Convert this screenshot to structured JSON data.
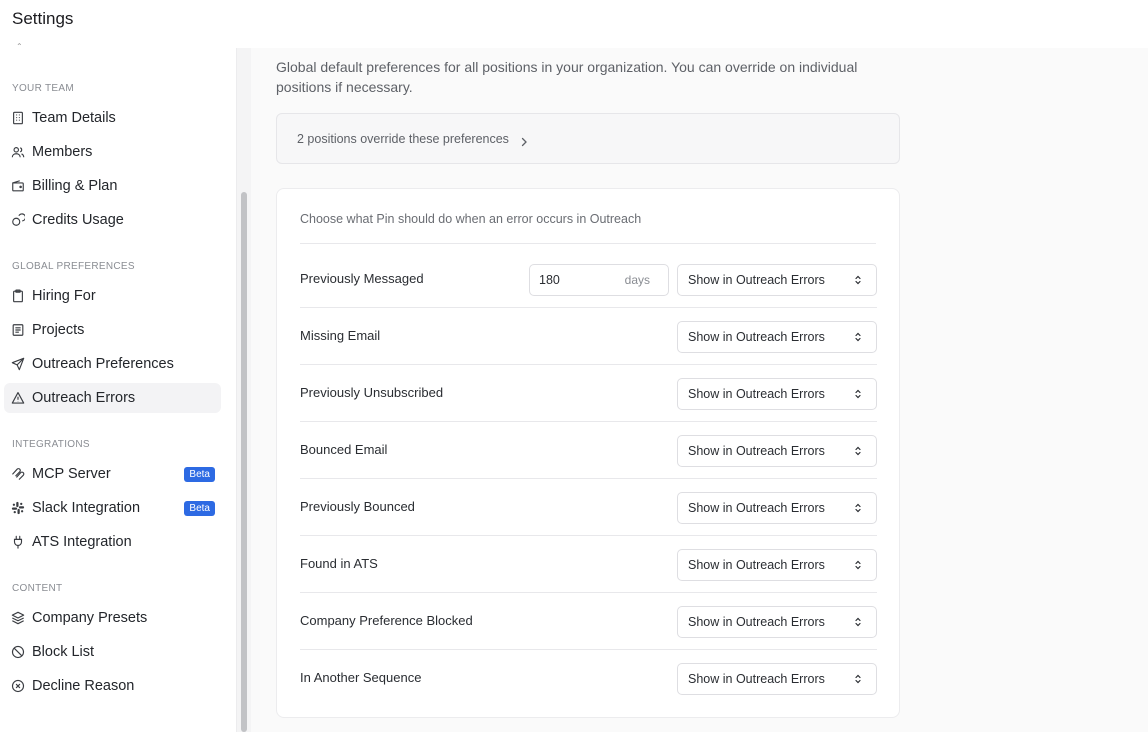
{
  "header": {
    "title": "Settings"
  },
  "sidebar": {
    "sections": [
      {
        "label": "YOUR TEAM",
        "items": [
          {
            "label": "Team Details",
            "icon": "building-icon"
          },
          {
            "label": "Members",
            "icon": "users-icon"
          },
          {
            "label": "Billing & Plan",
            "icon": "wallet-icon"
          },
          {
            "label": "Credits Usage",
            "icon": "coins-icon"
          }
        ]
      },
      {
        "label": "GLOBAL PREFERENCES",
        "items": [
          {
            "label": "Hiring For",
            "icon": "clipboard-icon"
          },
          {
            "label": "Projects",
            "icon": "list-icon"
          },
          {
            "label": "Outreach Preferences",
            "icon": "send-icon"
          },
          {
            "label": "Outreach Errors",
            "icon": "warning-icon",
            "active": true
          }
        ]
      },
      {
        "label": "INTEGRATIONS",
        "items": [
          {
            "label": "MCP Server",
            "icon": "mcp-icon",
            "badge": "Beta"
          },
          {
            "label": "Slack Integration",
            "icon": "slack-icon",
            "badge": "Beta"
          },
          {
            "label": "ATS Integration",
            "icon": "plug-icon"
          }
        ]
      },
      {
        "label": "CONTENT",
        "items": [
          {
            "label": "Company Presets",
            "icon": "layers-icon"
          },
          {
            "label": "Block List",
            "icon": "ban-icon"
          },
          {
            "label": "Decline Reason",
            "icon": "circle-x-icon"
          }
        ]
      }
    ]
  },
  "main": {
    "description": "Global default preferences for all positions in your organization. You can override on individual positions if necessary.",
    "override_text": "2 positions override these preferences",
    "card_intro": "Choose what Pin should do when an error occurs in Outreach",
    "rows": [
      {
        "label": "Previously Messaged",
        "days_value": "180",
        "days_unit": "days",
        "select": "Show in Outreach Errors"
      },
      {
        "label": "Missing Email",
        "select": "Show in Outreach Errors"
      },
      {
        "label": "Previously Unsubscribed",
        "select": "Show in Outreach Errors"
      },
      {
        "label": "Bounced Email",
        "select": "Show in Outreach Errors"
      },
      {
        "label": "Previously Bounced",
        "select": "Show in Outreach Errors"
      },
      {
        "label": "Found in ATS",
        "select": "Show in Outreach Errors"
      },
      {
        "label": "Company Preference Blocked",
        "select": "Show in Outreach Errors"
      },
      {
        "label": "In Another Sequence",
        "select": "Show in Outreach Errors"
      }
    ]
  },
  "colors": {
    "accent": "#2d6ae3",
    "active_bg": "#f3f3f5"
  }
}
